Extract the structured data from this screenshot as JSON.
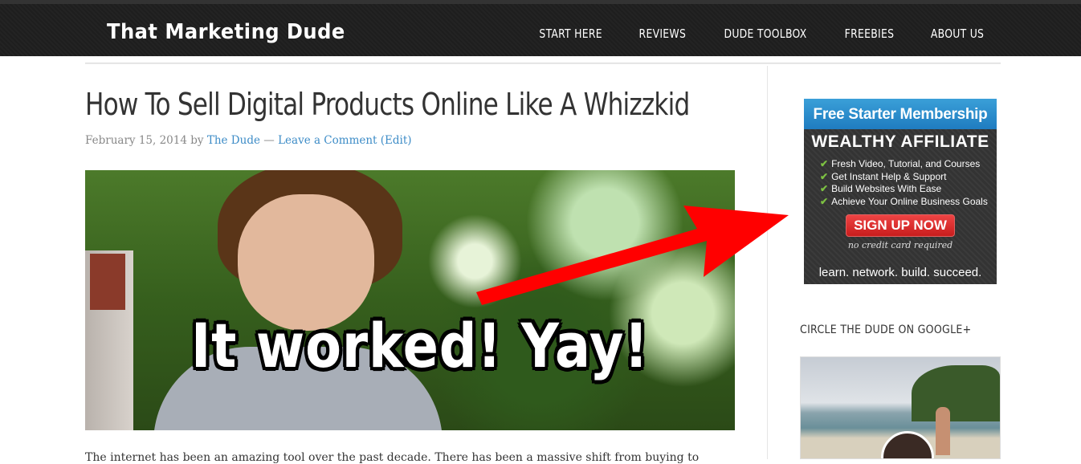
{
  "header": {
    "site_title": "That Marketing Dude",
    "nav": [
      "START HERE",
      "REVIEWS",
      "DUDE TOOLBOX",
      "FREEBIES",
      "ABOUT US"
    ]
  },
  "post": {
    "title": "How To Sell Digital Products Online Like A Whizzkid",
    "date": "February 15, 2014",
    "by": "by",
    "author": "The Dude",
    "separator": "—",
    "comment_link": "Leave a Comment",
    "edit_link": "(Edit)",
    "image_caption": "It worked! Yay!",
    "body_excerpt": "The internet has been an amazing tool over the past decade. There has been a massive shift from buying to"
  },
  "sidebar": {
    "ad": {
      "headline": "Free Starter Membership",
      "brand": "WEALTHY AFFILIATE",
      "features": [
        "Fresh Video, Tutorial, and Courses",
        "Get Instant Help & Support",
        "Build Websites With Ease",
        "Achieve Your Online Business Goals"
      ],
      "cta": "SIGN UP NOW",
      "note": "no credit card required",
      "tagline": "learn. network. build. succeed."
    },
    "gplus_widget_title": "CIRCLE THE DUDE ON GOOGLE+"
  },
  "colors": {
    "header_bg": "#1e1e1e",
    "link": "#3d8cc7",
    "arrow": "#ff0000",
    "cta": "#d92a2a"
  }
}
